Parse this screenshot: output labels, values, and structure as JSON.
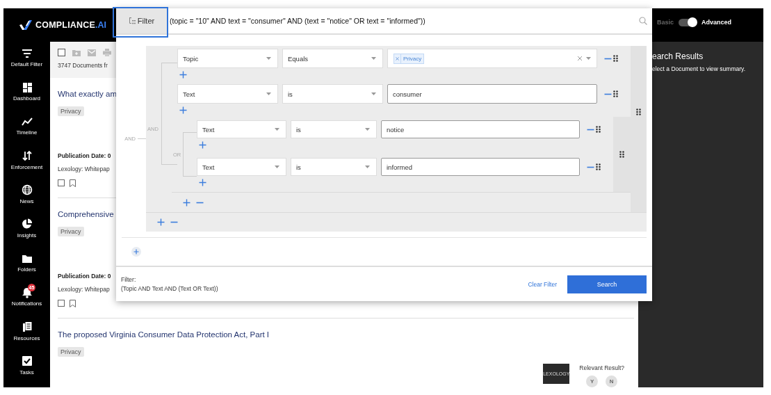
{
  "brand": {
    "name": "COMPLIANCE",
    "suffix": ".AI"
  },
  "mode_toggle": {
    "left": "Basic",
    "right": "Advanced",
    "on": true
  },
  "sidebar": {
    "items": [
      {
        "label": "Default Filter"
      },
      {
        "label": "Dashboard"
      },
      {
        "label": "Timeline"
      },
      {
        "label": "Enforcement"
      },
      {
        "label": "News"
      },
      {
        "label": "Insights"
      },
      {
        "label": "Folders"
      },
      {
        "label": "Notifications",
        "badge": "45"
      },
      {
        "label": "Resources"
      },
      {
        "label": "Tasks"
      }
    ]
  },
  "toolbar": {
    "count": "3747 Documents fr"
  },
  "documents": [
    {
      "title": "What exactly am",
      "tag": "Privacy",
      "date": "Publication Date: 0",
      "source": "Lexology: Whitepap"
    },
    {
      "title": "Comprehensive",
      "tag": "Privacy",
      "date": "Publication Date: 0",
      "source": "Lexology: Whitepap"
    },
    {
      "title": "The proposed Virginia Consumer Data Protection Act, Part I",
      "tag": "Privacy",
      "source_logo": "LEXOLOGY",
      "relevance": {
        "question": "Relevant Result?",
        "yes": "Y",
        "no": "N"
      }
    }
  ],
  "results_panel": {
    "title": "earch Results",
    "hint": "elect a Document to view summary."
  },
  "filter_panel": {
    "button": "Filter",
    "query": "(topic = \"10\" AND text = \"consumer\" AND (text = \"notice\" OR text = \"informed\"))",
    "builder": {
      "operator": "AND",
      "children": [
        {
          "kind": "group",
          "operator": "AND",
          "children": [
            {
              "kind": "rule",
              "field": "Topic",
              "op": "Equals",
              "chips": [
                "Privacy"
              ]
            },
            {
              "kind": "rule",
              "field": "Text",
              "op": "is",
              "value": "consumer"
            },
            {
              "kind": "group",
              "operator": "OR",
              "children": [
                {
                  "kind": "rule",
                  "field": "Text",
                  "op": "is",
                  "value": "notice"
                },
                {
                  "kind": "rule",
                  "field": "Text",
                  "op": "is",
                  "value": "informed"
                }
              ]
            }
          ]
        }
      ]
    },
    "footer": {
      "label": "Filter:",
      "summary": "(Topic AND Text AND (Text OR Text))",
      "clear": "Clear Filter",
      "search": "Search"
    }
  }
}
